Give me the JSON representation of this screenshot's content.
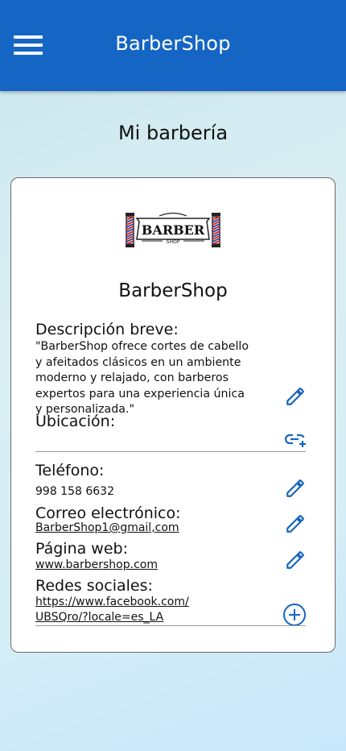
{
  "app_bar": {
    "title": "BarberShop",
    "menu_icon": "hamburger-menu-icon",
    "color": "#1566c4"
  },
  "page": {
    "title": "Mi barbería"
  },
  "card": {
    "logo": {
      "text": "BARBER",
      "subtext": "SHOP"
    },
    "shop_name": "BarberShop",
    "description": {
      "label": "Descripción breve:",
      "value": "\"BarberShop ofrece cortes de cabello y afeitados clásicos en un ambiente moderno y relajado, con barberos expertos para una experiencia única y personalizada.\"",
      "edit_icon": "pencil-icon"
    },
    "location": {
      "label": "Ubicación:",
      "value": "",
      "action_icon": "add-link-icon"
    },
    "phone": {
      "label": "Teléfono:",
      "value": "998 158 6632",
      "edit_icon": "pencil-icon"
    },
    "email": {
      "label": "Correo electrónico:",
      "value": "BarberShop1@gmail,com",
      "edit_icon": "pencil-icon"
    },
    "website": {
      "label": "Página web:",
      "value": "www.barbershop.com",
      "edit_icon": "pencil-icon"
    },
    "social": {
      "label": "Redes sociales:",
      "value_line1": "https://www.facebook.com/",
      "value_line2": "UBSQro/?locale=es_LA",
      "add_icon": "plus-circle-icon"
    }
  },
  "accent_color": "#1565c0"
}
